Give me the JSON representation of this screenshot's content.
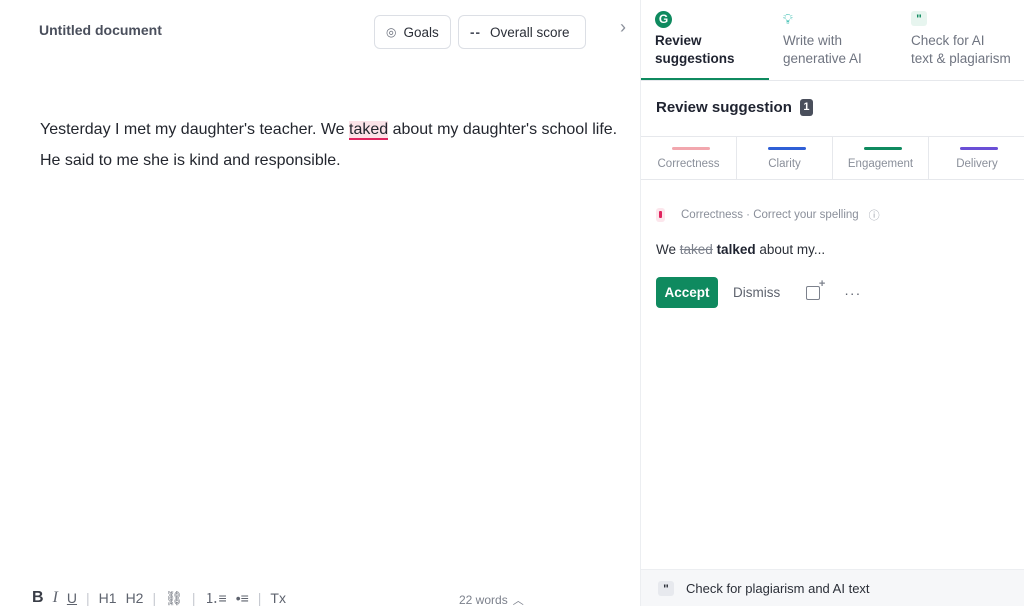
{
  "document": {
    "title": "Untitled document",
    "goals_label": "Goals",
    "score_prefix": "--",
    "score_label": "Overall score",
    "body": {
      "before": "Yesterday I met my daughter's teacher. We ",
      "error_word": "taked",
      "after": " about my daughter's school life. He said to me she is kind and responsible."
    },
    "word_count": "22 words"
  },
  "toolbar": {
    "bold": "B",
    "italic": "I",
    "underline": "U",
    "h1": "H1",
    "h2": "H2",
    "link": "⛓",
    "ordered_list": "⒈≡",
    "bullet_list": "•≡",
    "clear_format": "Tx"
  },
  "sidebar": {
    "tabs": [
      {
        "label_line1": "Review",
        "label_line2": "suggestions",
        "icon": "grammarly-g-icon"
      },
      {
        "label_line1": "Write with",
        "label_line2": "generative AI",
        "icon": "lightbulb-icon"
      },
      {
        "label_line1": "Check for AI",
        "label_line2": "text & plagiarism",
        "icon": "quote-icon"
      }
    ],
    "review_title": "Review suggestion",
    "review_count": "1",
    "categories": [
      {
        "label": "Correctness",
        "color": "#e0245e"
      },
      {
        "label": "Clarity",
        "color": "#2f5fd6"
      },
      {
        "label": "Engagement",
        "color": "#0f8a5f"
      },
      {
        "label": "Delivery",
        "color": "#6a4fd6"
      }
    ],
    "card": {
      "category": "Correctness · Correct your spelling",
      "preview_prefix": "We ",
      "preview_old": "taked",
      "preview_new": "talked",
      "preview_suffix": " about my...",
      "accept_label": "Accept",
      "dismiss_label": "Dismiss",
      "more_label": "···"
    },
    "footer_label": "Check for plagiarism and AI text"
  }
}
